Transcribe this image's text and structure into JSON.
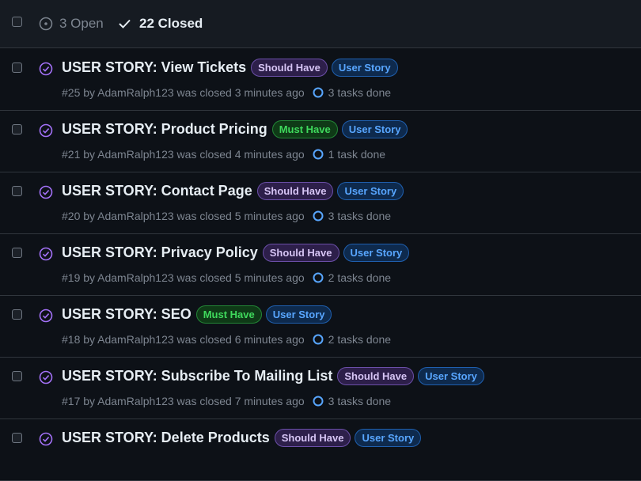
{
  "header": {
    "open_label": "3 Open",
    "closed_label": "22 Closed"
  },
  "colors": {
    "background": "#0d1117",
    "closed_icon": "#a371f7",
    "task_icon": "#58a6ff"
  },
  "issues": [
    {
      "title": "USER STORY: View Tickets",
      "priority": "Should Have",
      "type": "User Story",
      "meta": "#25 by AdamRalph123 was closed 3 minutes ago",
      "tasks": "3 tasks done"
    },
    {
      "title": "USER STORY: Product Pricing",
      "priority": "Must Have",
      "type": "User Story",
      "meta": "#21 by AdamRalph123 was closed 4 minutes ago",
      "tasks": "1 task done"
    },
    {
      "title": "USER STORY: Contact Page",
      "priority": "Should Have",
      "type": "User Story",
      "meta": "#20 by AdamRalph123 was closed 5 minutes ago",
      "tasks": "3 tasks done"
    },
    {
      "title": "USER STORY: Privacy Policy",
      "priority": "Should Have",
      "type": "User Story",
      "meta": "#19 by AdamRalph123 was closed 5 minutes ago",
      "tasks": "2 tasks done"
    },
    {
      "title": "USER STORY: SEO",
      "priority": "Must Have",
      "type": "User Story",
      "meta": "#18 by AdamRalph123 was closed 6 minutes ago",
      "tasks": "2 tasks done"
    },
    {
      "title": "USER STORY: Subscribe To Mailing List",
      "priority": "Should Have",
      "type": "User Story",
      "meta": "#17 by AdamRalph123 was closed 7 minutes ago",
      "tasks": "3 tasks done"
    },
    {
      "title": "USER STORY: Delete Products",
      "priority": "Should Have",
      "type": "User Story",
      "meta": "",
      "tasks": ""
    }
  ]
}
